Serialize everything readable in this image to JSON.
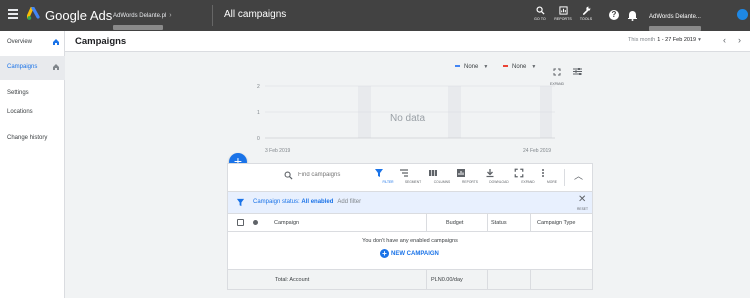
{
  "header": {
    "app_name": "Google Ads",
    "account_name": "AdWords Delante.pl",
    "view_title": "All campaigns",
    "tools": [
      {
        "label": "GO TO",
        "icon": "search-icon"
      },
      {
        "label": "REPORTS",
        "icon": "reports-icon"
      },
      {
        "label": "TOOLS",
        "icon": "wrench-icon"
      }
    ],
    "help_icon": "help-icon",
    "notification_icon": "bell-icon",
    "user_name": "AdWords Delante...",
    "avatar_color": "#1e88e5"
  },
  "sidebar": {
    "items": [
      {
        "label": "Overview",
        "active": false
      },
      {
        "label": "Campaigns",
        "active": true
      },
      {
        "label": "Settings",
        "active": false
      },
      {
        "label": "Locations",
        "active": false
      },
      {
        "label": "Change history",
        "active": false
      }
    ]
  },
  "page": {
    "title": "Campaigns",
    "date_prefix": "This month",
    "date_range": "1 - 27 Feb 2019"
  },
  "chart_controls": {
    "series1": {
      "label": "None",
      "color": "#4285f4"
    },
    "series2": {
      "label": "None",
      "color": "#ea4335"
    },
    "expand_label": "EXPAND"
  },
  "chart_data": {
    "type": "line",
    "y_ticks": [
      "2",
      "1",
      "0"
    ],
    "ylim": [
      0,
      2
    ],
    "x_start": "3 Feb 2019",
    "x_end": "24 Feb 2019",
    "message": "No data",
    "series": []
  },
  "table": {
    "search_placeholder": "Find campaigns",
    "toolbar": [
      {
        "label": "FILTER",
        "icon": "filter-icon",
        "active": true
      },
      {
        "label": "SEGMENT",
        "icon": "segment-icon",
        "active": false
      },
      {
        "label": "COLUMNS",
        "icon": "columns-icon",
        "active": false
      },
      {
        "label": "REPORTS",
        "icon": "reports-icon",
        "active": false
      },
      {
        "label": "DOWNLOAD",
        "icon": "download-icon",
        "active": false
      },
      {
        "label": "EXPAND",
        "icon": "expand-icon",
        "active": false
      },
      {
        "label": "MORE",
        "icon": "more-icon",
        "active": false
      }
    ],
    "filter": {
      "prefix": "Campaign status:",
      "value": "All enabled",
      "add_label": "Add filter",
      "reset_label": "RESET"
    },
    "columns": [
      "Campaign",
      "Budget",
      "Status",
      "Campaign Type"
    ],
    "empty_message": "You don't have any enabled campaigns",
    "new_campaign_label": "NEW CAMPAIGN",
    "total": {
      "label": "Total: Account",
      "budget": "PLN0.00/day"
    }
  },
  "colors": {
    "accent": "#1a73e8",
    "topbar": "#424242"
  }
}
